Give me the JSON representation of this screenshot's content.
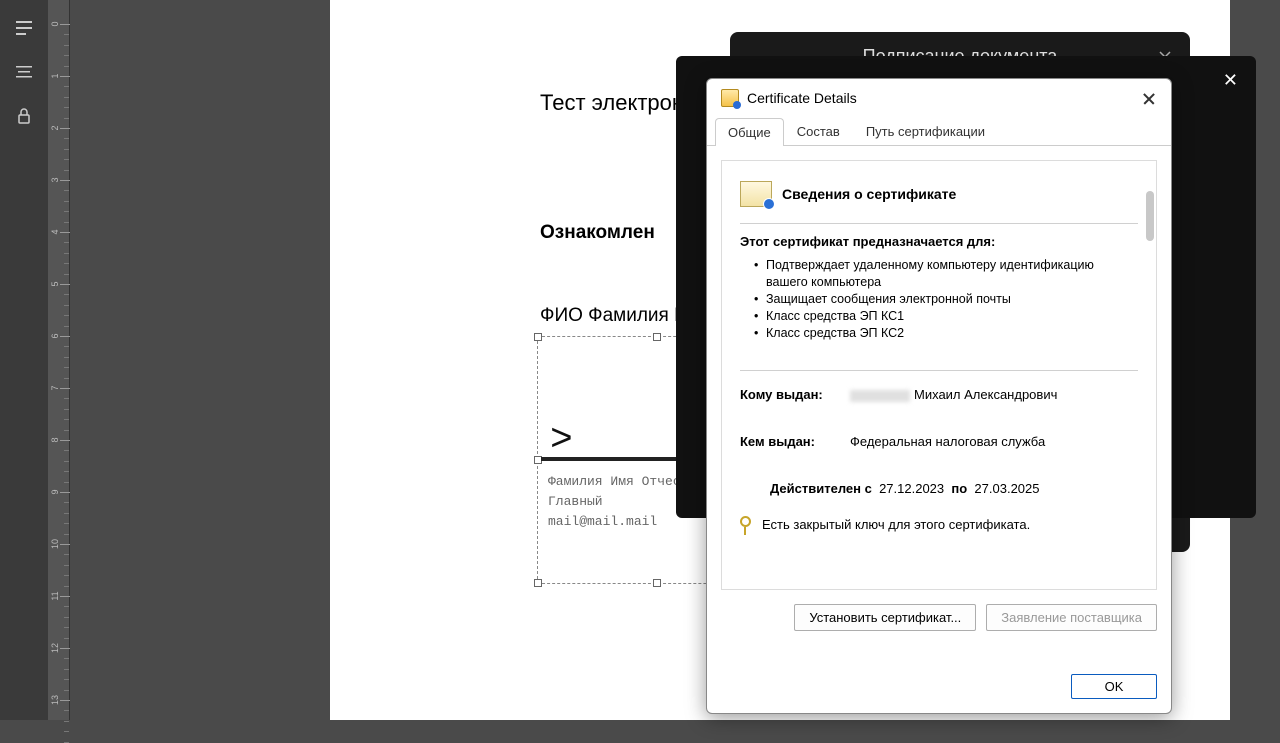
{
  "toolbar": {
    "icons": [
      "toc-icon",
      "paragraph-icon",
      "lock-icon"
    ]
  },
  "ruler": {
    "units": [
      0,
      1,
      2,
      3,
      4,
      5,
      6,
      7,
      8,
      9,
      10,
      11,
      12,
      13
    ]
  },
  "document": {
    "title": "Тест электронной подписи",
    "acknowledged": "Ознакомлен",
    "fio_label": "ФИО Фамилия Имя Отчество",
    "signature": {
      "arrow": ">",
      "line1": "Фамилия Имя Отчество",
      "line2": "Главный",
      "line3": "mail@mail.mail"
    }
  },
  "sign_panel": {
    "title": "Подписание документа",
    "visible_fragment": "о"
  },
  "cert_dialog": {
    "title": "Certificate Details",
    "tabs": [
      "Общие",
      "Состав",
      "Путь сертификации"
    ],
    "active_tab": 0,
    "header": "Сведения о сертификате",
    "purpose_title": "Этот сертификат предназначается для:",
    "purposes": [
      "Подтверждает удаленному компьютеру идентификацию вашего компьютера",
      "Защищает сообщения электронной почты",
      "Класс средства ЭП КС1",
      "Класс средства ЭП КС2"
    ],
    "issued_to_label": "Кому выдан:",
    "issued_to_value": "Михаил Александрович",
    "issued_by_label": "Кем выдан:",
    "issued_by_value": "Федеральная налоговая служба",
    "valid_from_label": "Действителен с",
    "valid_from": "27.12.2023",
    "valid_to_label": "по",
    "valid_to": "27.03.2025",
    "private_key_text": "Есть закрытый ключ для этого сертификата.",
    "btn_install": "Установить сертификат...",
    "btn_statement": "Заявление поставщика",
    "btn_ok": "OK"
  }
}
